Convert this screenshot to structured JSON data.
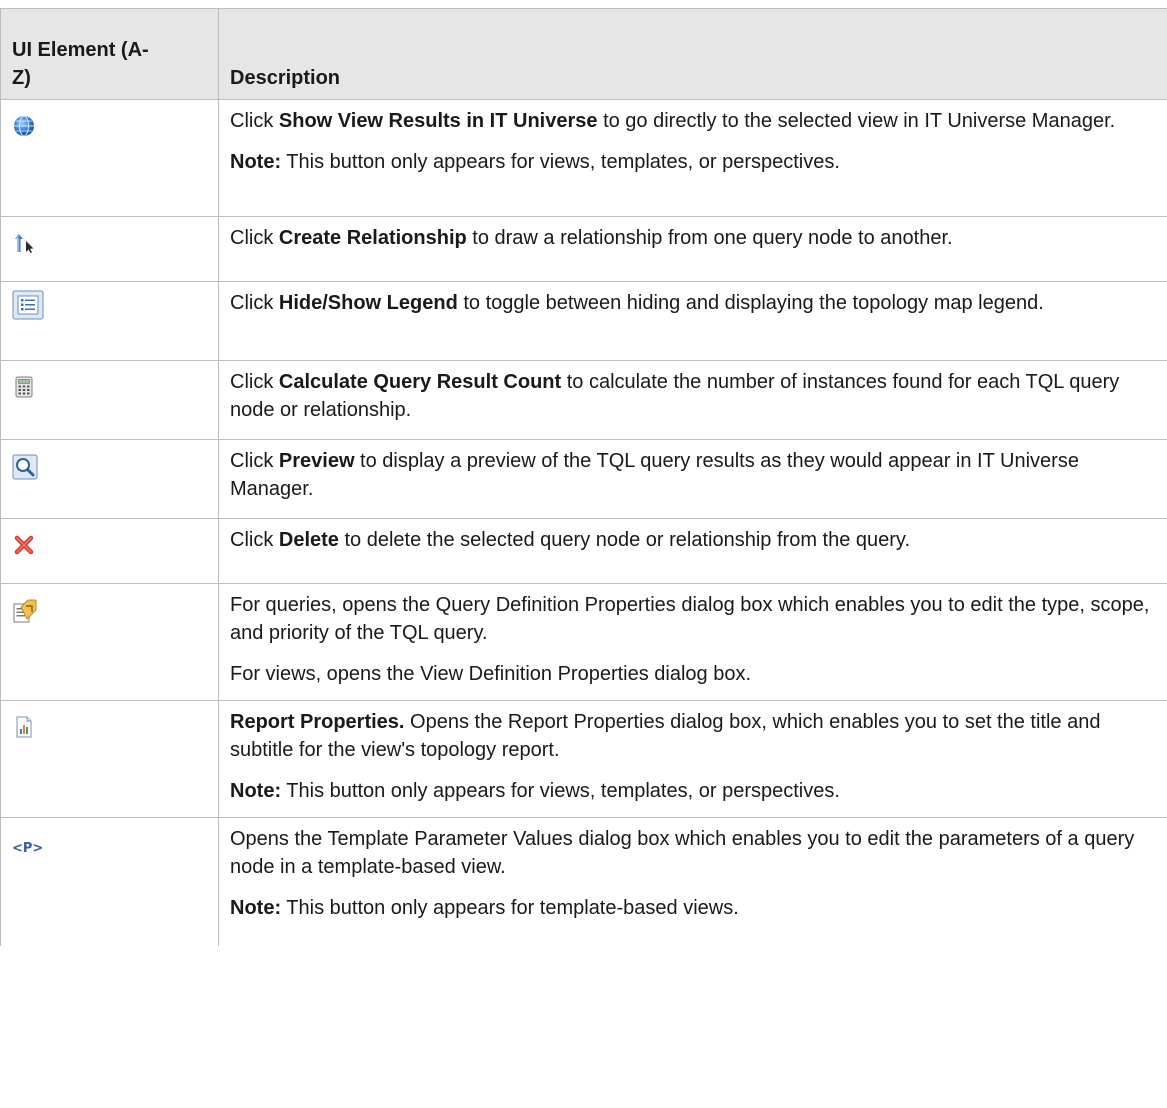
{
  "header": {
    "col1": "UI Element (A-Z)",
    "col1_line1": "UI Element (A-",
    "col1_line2": "Z)",
    "col2": "Description"
  },
  "rows": [
    {
      "icon": "globe-icon",
      "p1": {
        "pre": "Click ",
        "bold": "Show View Results in IT Universe",
        "post": " to go directly to the selected view in IT Universe Manager."
      },
      "p2": {
        "bold": "Note:",
        "post": " This button only appears for views, templates, or perspectives."
      }
    },
    {
      "icon": "create-relationship-icon",
      "p1": {
        "pre": "Click ",
        "bold": "Create Relationship",
        "post": " to draw a relationship from one query node to another."
      }
    },
    {
      "icon": "legend-icon",
      "p1": {
        "pre": "Click ",
        "bold": "Hide/Show Legend",
        "post": " to toggle between hiding and displaying the topology map legend."
      }
    },
    {
      "icon": "calculator-icon",
      "p1": {
        "pre": "Click ",
        "bold": "Calculate Query Result Count",
        "post": " to calculate the number of instances found for each TQL query node or relationship."
      }
    },
    {
      "icon": "magnifier-icon",
      "p1": {
        "pre": "Click ",
        "bold": "Preview",
        "post": " to display a preview of the TQL query results as they would appear in IT Universe Manager."
      }
    },
    {
      "icon": "delete-x-icon",
      "p1": {
        "pre": "Click ",
        "bold": "Delete",
        "post": " to delete the selected query node or relationship from the query."
      }
    },
    {
      "icon": "properties-icon",
      "p1": {
        "text": "For queries, opens the Query Definition Properties dialog box which enables you to edit the type, scope, and priority of the TQL query."
      },
      "p2": {
        "text": "For views, opens the View Definition Properties dialog box."
      }
    },
    {
      "icon": "report-properties-icon",
      "p1": {
        "bold": "Report Properties.",
        "post": " Opens the Report Properties dialog box, which enables you to set the title and subtitle for the view's topology report."
      },
      "p2": {
        "bold": "Note:",
        "post": " This button only appears for views, templates, or perspectives."
      }
    },
    {
      "icon": "template-parameter-icon",
      "icon_text": "<P>",
      "p1": {
        "text": "Opens the Template Parameter Values dialog box which enables you to edit the parameters of a query node in a template-based view."
      },
      "p2": {
        "bold": "Note:",
        "post": " This button only appears for template-based views."
      }
    }
  ]
}
